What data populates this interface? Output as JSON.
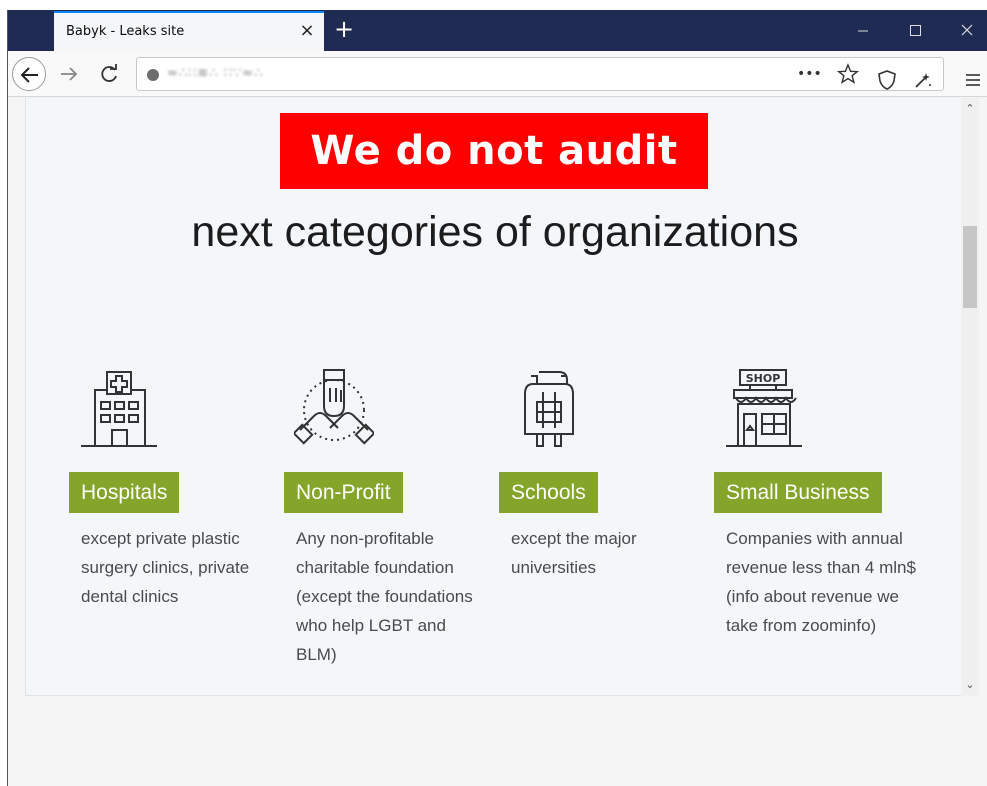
{
  "browser": {
    "tab_title": "Babyk - Leaks site",
    "tab_close": "×",
    "new_tab": "+",
    "url": "≈∴∷≋∴ ∷∵≈∴",
    "page_actions": "•••",
    "icons": [
      "back-arrow-icon",
      "forward-arrow-icon",
      "reload-icon",
      "site-identity-icon",
      "bookmark-star-icon",
      "shield-icon",
      "extension-icon",
      "hamburger-menu-icon",
      "minimize-icon",
      "maximize-icon",
      "close-icon"
    ]
  },
  "page": {
    "headline": "We do not audit",
    "subheadline": "next categories of organizations",
    "accent_color": "#ff0000",
    "label_color": "#84a52a",
    "categories": [
      {
        "label": "Hospitals",
        "icon": "hospital-icon",
        "description": "except private plastic surgery clinics, private dental clinics"
      },
      {
        "label": "Non-Profit",
        "icon": "charity-hands-icon",
        "description": "Any non-profitable charitable foundation (except the foundations who help LGBT and BLM)"
      },
      {
        "label": "Schools",
        "icon": "backpack-icon",
        "description": "except the major universities"
      },
      {
        "label": "Small Business",
        "icon": "shop-icon",
        "description": "Companies with annual revenue less than 4 mln$ (info about revenue we take from zoominfo)"
      }
    ]
  }
}
